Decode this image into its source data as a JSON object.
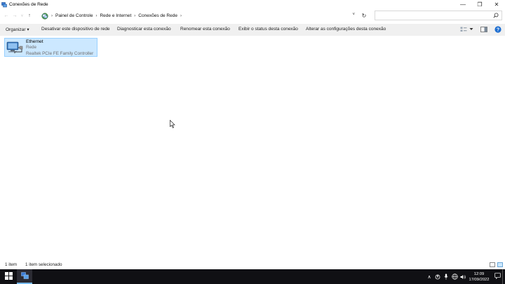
{
  "window": {
    "title": "Conexões de Rede",
    "minimize": "—",
    "restore": "❐",
    "close": "✕"
  },
  "address": {
    "back": "←",
    "forward": "→",
    "recent": "˅",
    "up": "↑",
    "breadcrumb": [
      "Painel de Controle",
      "Rede e Internet",
      "Conexões de Rede"
    ],
    "separator": "›",
    "dropdown": "˅",
    "refresh": "↻",
    "search_value": "",
    "search_placeholder": ""
  },
  "commands": {
    "organize": "Organizar ▾",
    "disable": "Desativar este dispositivo de rede",
    "diagnose": "Diagnosticar esta conexão",
    "rename": "Renomear esta conexão",
    "status": "Exibir o status desta conexão",
    "change_settings": "Alterar as configurações desta conexão"
  },
  "items": [
    {
      "name": "Ethernet",
      "type": "Rede",
      "adapter": "Realtek PCIe FE Family Controller"
    }
  ],
  "statusbar": {
    "count": "1 item",
    "selected": "1 item selecionado"
  },
  "taskbar": {
    "time": "12:09",
    "date": "17/09/2022",
    "chevron": "∧"
  },
  "colors": {
    "selection_bg": "#cce8ff",
    "selection_border": "#99d1ff",
    "taskbar": "#101014",
    "accent": "#0078d7"
  }
}
